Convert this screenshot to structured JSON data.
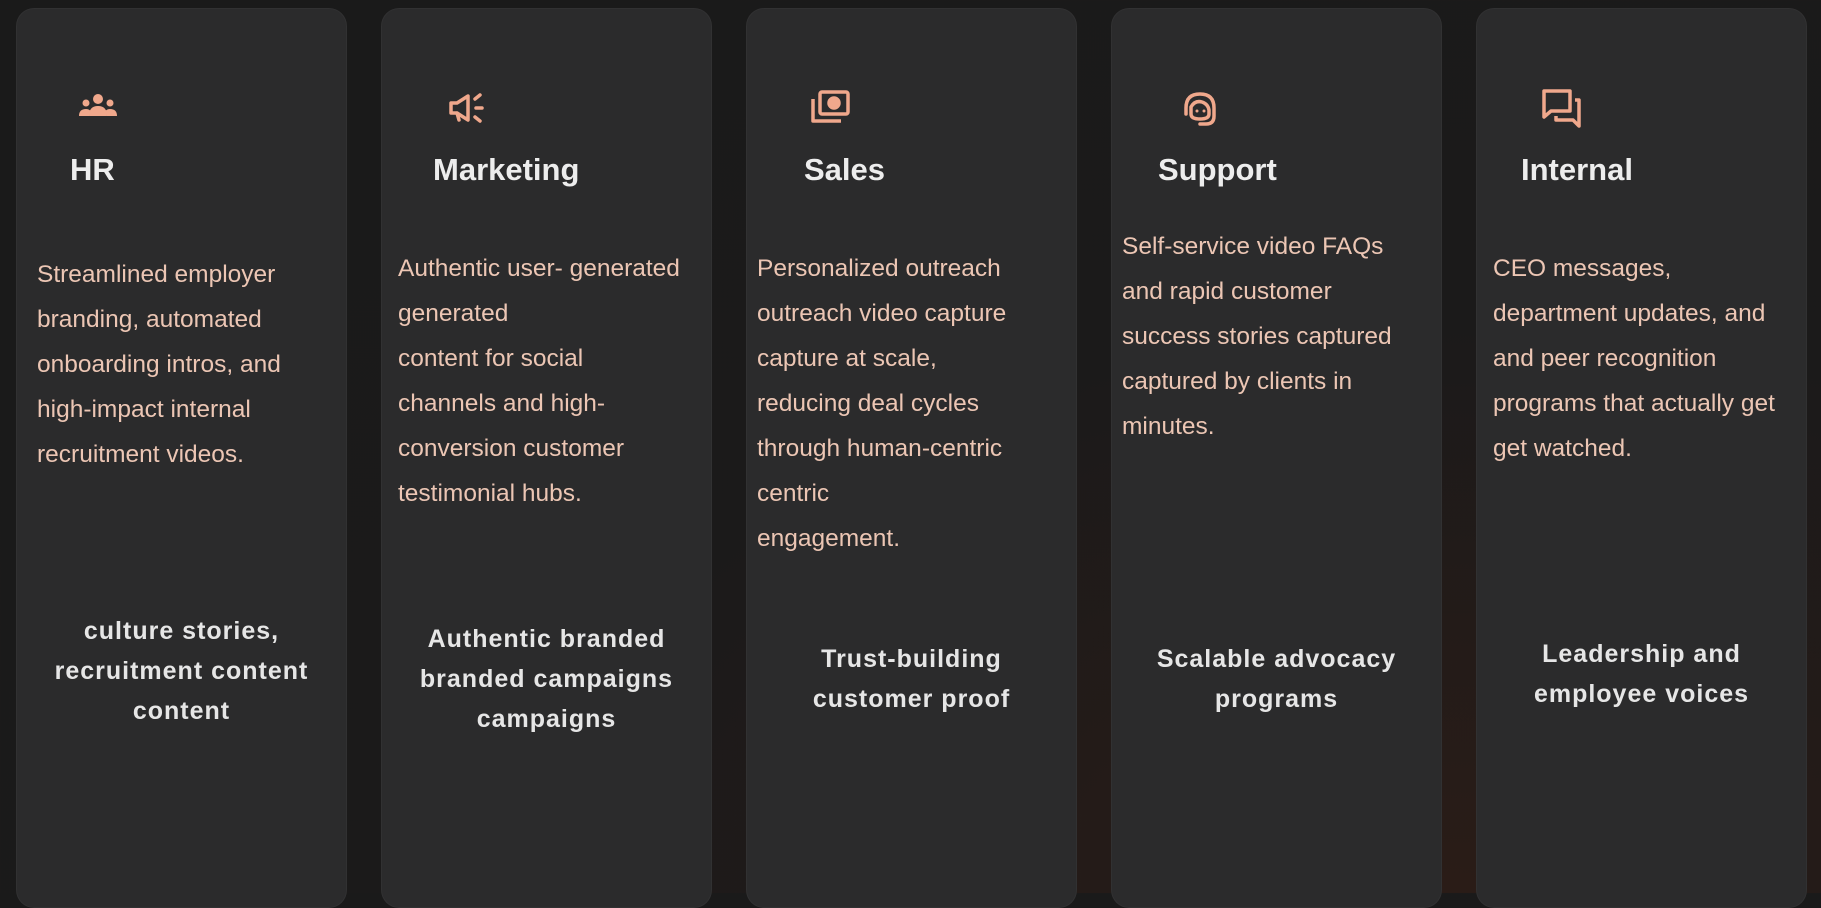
{
  "accent_color": "#f0a88c",
  "cards": [
    {
      "icon": "people-group-icon",
      "title": "HR",
      "description": "Streamlined employer\nbranding, automated\nonboarding intros, and\nhigh-impact internal\nrecruitment videos.",
      "tagline": "culture stories,\nrecruitment content\ncontent"
    },
    {
      "icon": "megaphone-icon",
      "title": "Marketing",
      "description": "Authentic user- generated\ngenerated\ncontent for social\nchannels and high-\nconversion customer\ntestimonial hubs.",
      "tagline": "Authentic branded\nbranded campaigns\ncampaigns"
    },
    {
      "icon": "money-icon",
      "title": "Sales",
      "description": "Personalized outreach\noutreach video capture\ncapture at scale,\nreducing deal cycles\nthrough human-centric\ncentric\nengagement.",
      "tagline": "Trust-building\ncustomer proof"
    },
    {
      "icon": "headset-icon",
      "title": "Support",
      "description": "Self-service video FAQs\nand rapid customer\nsuccess stories captured\ncaptured by clients in\nminutes.",
      "tagline": "Scalable advocacy\nprograms"
    },
    {
      "icon": "chat-bubbles-icon",
      "title": "Internal",
      "description": "CEO messages,\ndepartment updates, and\nand peer recognition\nprograms that actually get\nget watched.",
      "tagline": "Leadership and\nemployee voices"
    }
  ]
}
